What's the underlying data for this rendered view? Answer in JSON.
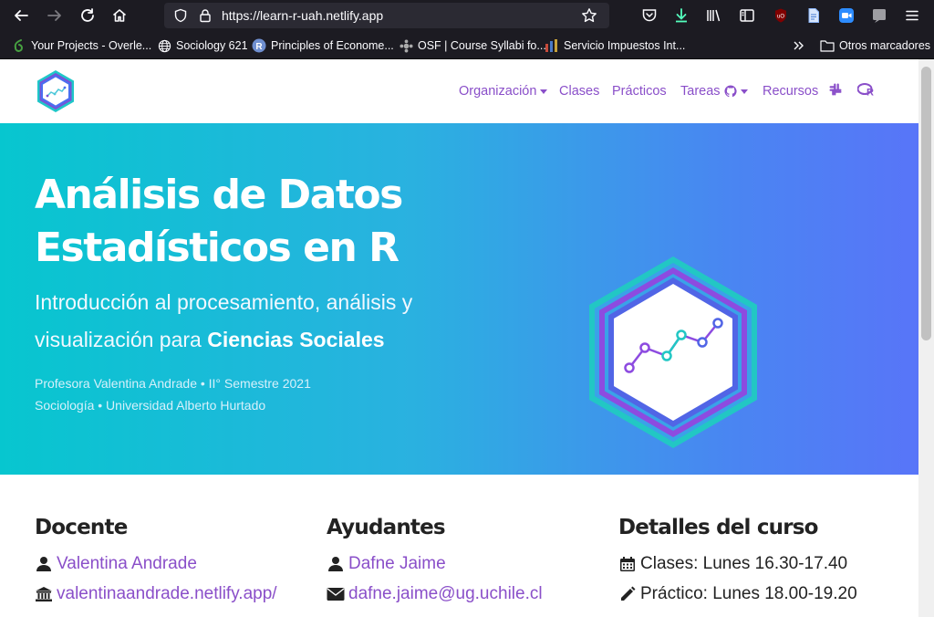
{
  "browser": {
    "url": "https://learn-r-uah.netlify.app",
    "bookmarks": [
      "Your Projects - Overle...",
      "Sociology 621",
      "Principles of Econome...",
      "OSF | Course Syllabi fo...",
      "Servicio Impuestos Int..."
    ],
    "other_bookmarks": "Otros marcadores"
  },
  "nav": {
    "items": [
      "Organización",
      "Clases",
      "Prácticos",
      "Tareas",
      "Recursos"
    ]
  },
  "hero": {
    "title_line1": "Análisis de Datos",
    "title_line2": "Estadísticos en R",
    "subtitle_line1": "Introducción al procesamiento, análisis y",
    "subtitle_line2_prefix": "visualización para ",
    "subtitle_line2_bold": "Ciencias Sociales",
    "meta_line1": "Profesora Valentina Andrade • II° Semestre 2021",
    "meta_line2": "Sociología • Universidad Alberto Hurtado"
  },
  "docente": {
    "heading": "Docente",
    "name": "Valentina Andrade",
    "website": "valentinaandrade.netlify.app/"
  },
  "ayudantes": {
    "heading": "Ayudantes",
    "name": "Dafne Jaime",
    "email": "dafne.jaime@ug.uchile.cl"
  },
  "detalles": {
    "heading": "Detalles del curso",
    "clases": "Clases: Lunes 16.30-17.40",
    "practico": "Práctico: Lunes 18.00-19.20"
  },
  "colors": {
    "accent": "#8a4fc9",
    "hero_start": "#07c6cf",
    "hero_end": "#5875f8"
  }
}
